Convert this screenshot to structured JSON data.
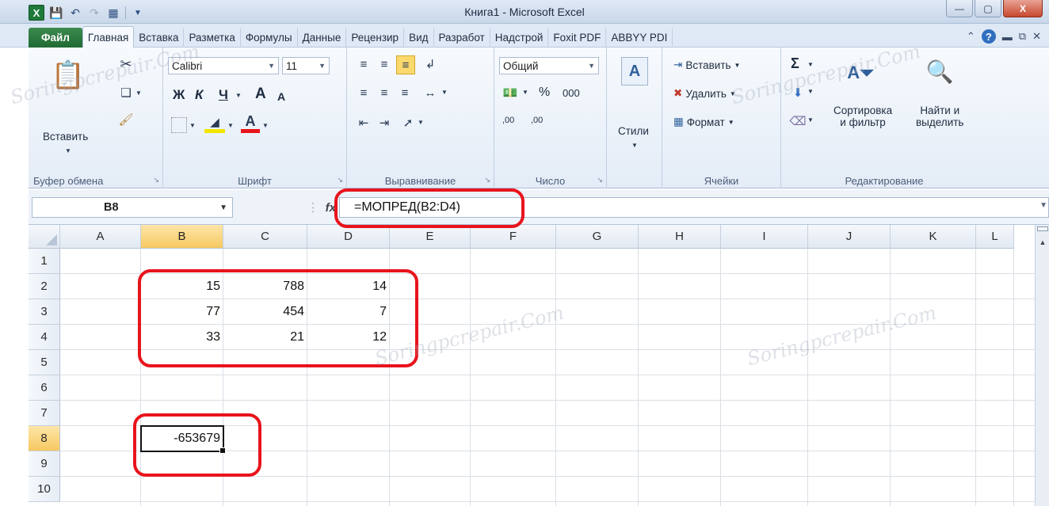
{
  "window": {
    "title": "Книга1  -  Microsoft Excel",
    "minimize": "—",
    "restore": "▢",
    "close": "X"
  },
  "tabs": [
    {
      "label": "Файл"
    },
    {
      "label": "Главная"
    },
    {
      "label": "Вставка"
    },
    {
      "label": "Разметка"
    },
    {
      "label": "Формулы"
    },
    {
      "label": "Данные"
    },
    {
      "label": "Рецензир"
    },
    {
      "label": "Вид"
    },
    {
      "label": "Разработ"
    },
    {
      "label": "Надстрой"
    },
    {
      "label": "Foxit PDF"
    },
    {
      "label": "ABBYY PDI"
    }
  ],
  "ribbon": {
    "clipboard": {
      "paste": "Вставить",
      "label": "Буфер обмена"
    },
    "font": {
      "name": "Calibri",
      "size": "11",
      "label": "Шрифт",
      "bold": "Ж",
      "italic": "К",
      "underline": "Ч",
      "grow": "A",
      "shrink": "A"
    },
    "alignment": {
      "label": "Выравнивание"
    },
    "number": {
      "format": "Общий",
      "percent": "%",
      "thousands": "000",
      "label": "Число",
      "inc_dec": ",00",
      "dec_dec": ",00"
    },
    "styles": {
      "label": "Стили"
    },
    "cells": {
      "insert": "Вставить",
      "delete": "Удалить",
      "format": "Формат",
      "label": "Ячейки"
    },
    "editing": {
      "sort_line1": "Сортировка",
      "sort_line2": "и фильтр",
      "find_line1": "Найти и",
      "find_line2": "выделить",
      "label": "Редактирование",
      "sigma": "Σ"
    }
  },
  "formula_bar": {
    "name_box": "B8",
    "fx": "fx",
    "formula": "=МОПРЕД(B2:D4)"
  },
  "grid": {
    "columns": [
      "A",
      "B",
      "C",
      "D",
      "E",
      "F",
      "G",
      "H",
      "I",
      "J",
      "K",
      "L"
    ],
    "rows": [
      "1",
      "2",
      "3",
      "4",
      "5",
      "6",
      "7",
      "8",
      "9",
      "10"
    ],
    "selected_column": "B",
    "selected_row": "8",
    "cells": {
      "B2": "15",
      "C2": "788",
      "D2": "14",
      "B3": "77",
      "C3": "454",
      "D3": "7",
      "B4": "33",
      "C4": "21",
      "D4": "12",
      "B8": "-653679"
    }
  },
  "watermark": "Soringpcrepair.Com",
  "colors": {
    "annotation": "#e8141c",
    "file_tab": "#1f6a33",
    "selection_header": "#f7c860"
  }
}
